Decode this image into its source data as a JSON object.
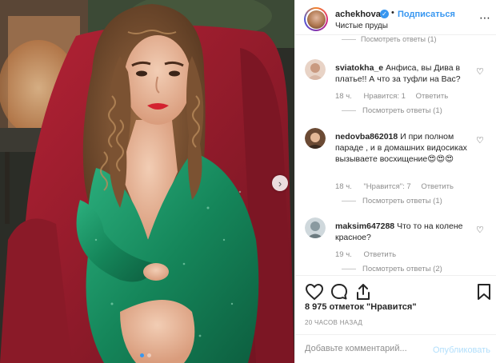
{
  "header": {
    "username": "achekhova",
    "separator": "•",
    "follow_label": "Подписаться",
    "location": "Чистые пруды",
    "more_icon": "more-options-icon"
  },
  "comments_partial": "Посмотреть ответы (1)",
  "comments": [
    {
      "username": "sviatokha_e",
      "text": "Анфиса, вы Дива в платье!! А что за туфли на Вас?",
      "time": "18 ч.",
      "likes": "Нравится: 1",
      "reply": "Ответить",
      "view_replies": "Посмотреть ответы (1)"
    },
    {
      "username": "nedovba862018",
      "text": "И при полном параде , и в домашних видосиках вызываете восхищение😍😍😍",
      "time": "18 ч.",
      "likes": "\"Нравится\": 7",
      "reply": "Ответить",
      "view_replies": "Посмотреть ответы (1)"
    },
    {
      "username": "maksim647288",
      "text": "Что то на колене красное?",
      "time": "19 ч.",
      "likes": "",
      "reply": "Ответить",
      "view_replies": "Посмотреть ответы (2)"
    }
  ],
  "likes_count": "8 975 отметок \"Нравится\"",
  "post_time": "20 ЧАСОВ НАЗАД",
  "comment_input": {
    "placeholder": "Добавьте комментарий...",
    "value": ""
  },
  "publish_label": "Опубликовать",
  "colors": {
    "accent": "#3897f0",
    "dress": "#1f9a6a",
    "chair": "#9c1c2c",
    "publish_disabled": "#b2dffc"
  }
}
